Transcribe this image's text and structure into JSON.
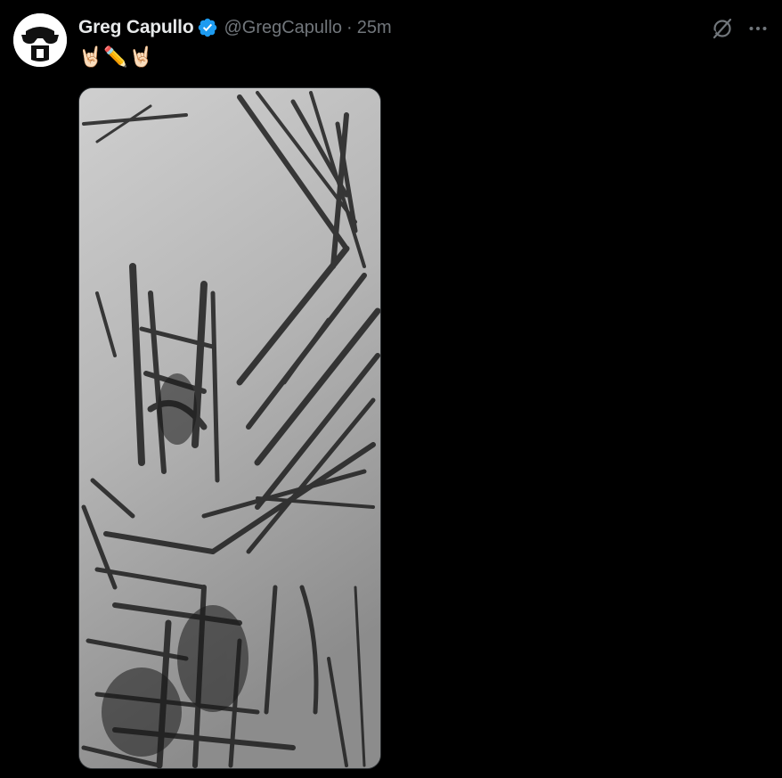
{
  "author": {
    "display_name": "Greg Capullo",
    "handle": "@GregCapullo",
    "separator": "·",
    "timestamp": "25m",
    "verified": true,
    "verified_color": "#1d9bf0",
    "avatar_icon": "sunglasses-face-avatar"
  },
  "tweet": {
    "text": "🤘🏻✏️🤘🏻"
  },
  "actions": {
    "grok_icon": "grok-icon",
    "more_icon": "more-options-icon"
  },
  "media": {
    "type": "image",
    "subject": "pencil-sketch-image"
  },
  "colors": {
    "background": "#000000",
    "primary_text": "#e7e9ea",
    "secondary_text": "#71767b"
  }
}
